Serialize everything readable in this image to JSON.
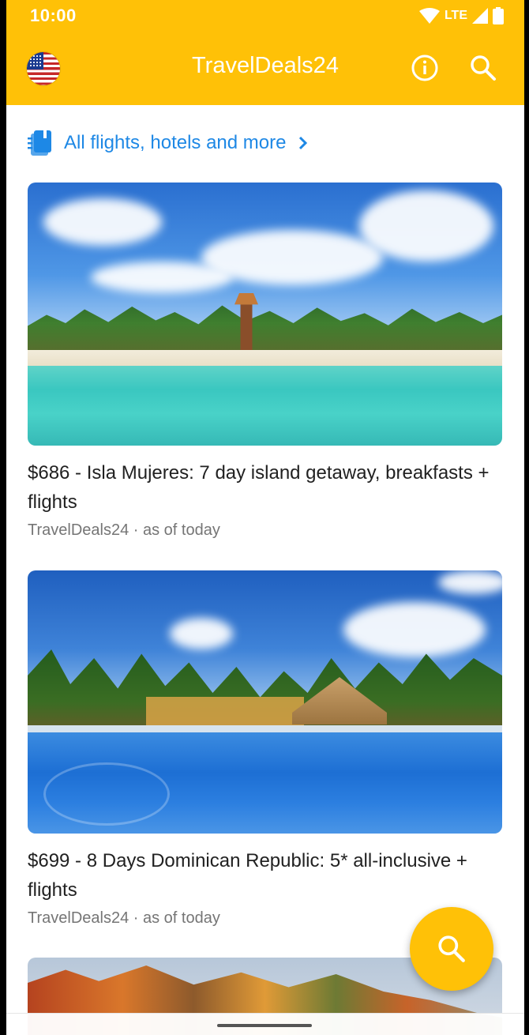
{
  "status_bar": {
    "time": "10:00",
    "network": "LTE",
    "icons": [
      "wifi-icon",
      "signal-icon",
      "battery-icon"
    ]
  },
  "app_bar": {
    "title": "TravelDeals24",
    "icons": [
      "us-flag-icon",
      "info-icon",
      "search-icon"
    ],
    "color": "#FFC107"
  },
  "all_link": {
    "label": "All flights, hotels and more",
    "icon": "catalog-icon",
    "color": "#1E88E5"
  },
  "deals": [
    {
      "title": "$686 - Isla Mujeres: 7 day island getaway, breakfasts + flights",
      "source": "TravelDeals24",
      "date": "as of today",
      "image": "tropical-beach-photo"
    },
    {
      "title": "$699 - 8 Days Dominican Republic: 5* all-inclusive + flights",
      "source": "TravelDeals24",
      "date": "as of today",
      "image": "resort-pool-photo"
    },
    {
      "image": "autumn-forest-photo"
    }
  ],
  "fab": {
    "icon": "search-icon"
  }
}
